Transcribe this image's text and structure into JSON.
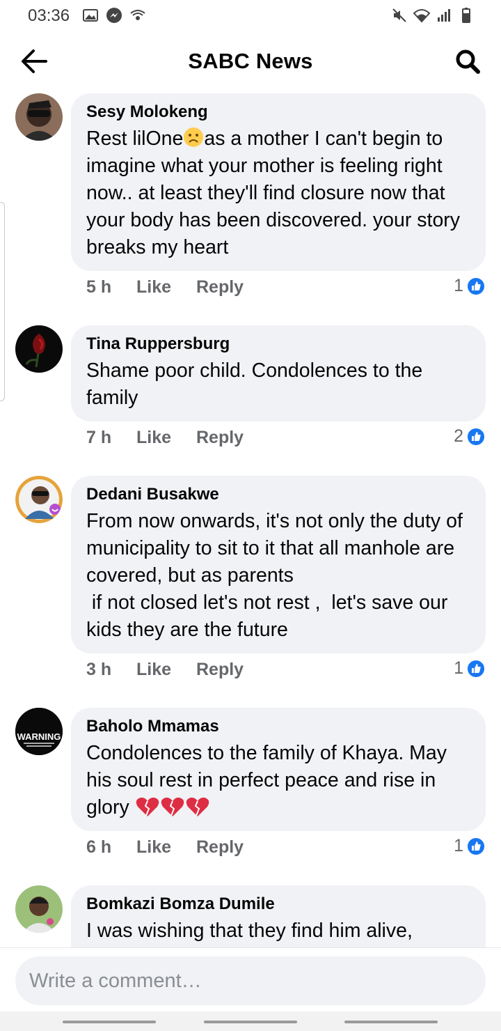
{
  "status_bar": {
    "time": "03:36",
    "left_icons": [
      "gallery-icon",
      "messenger-icon",
      "wifi-calling-icon"
    ],
    "right_icons": [
      "mute-icon",
      "wifi-icon",
      "signal-icon",
      "battery-icon"
    ]
  },
  "header": {
    "title": "SABC News",
    "back_icon": "back-arrow-icon",
    "search_icon": "search-icon"
  },
  "comments": [
    {
      "author": "Sesy Molokeng",
      "text_before_emoji": "Rest lilOne",
      "emoji": "sad-face",
      "text_after_emoji": "as a mother I can't begin to imagine what your mother is feeling right now.. at least they'll find closure now that your body has been discovered. your story breaks my heart",
      "time": "5 h",
      "like_label": "Like",
      "reply_label": "Reply",
      "reaction_count": "1"
    },
    {
      "author": "Tina Ruppersburg",
      "text": "Shame poor child. Condolences to the family",
      "time": "7 h",
      "like_label": "Like",
      "reply_label": "Reply",
      "reaction_count": "2"
    },
    {
      "author": "Dedani Busakwe",
      "text": "From now onwards, it's not only the duty of municipality to sit to it that all manhole are covered, but as parents\n if not closed let's not rest ,  let's save our kids they are the future",
      "time": "3 h",
      "like_label": "Like",
      "reply_label": "Reply",
      "reaction_count": "1"
    },
    {
      "author": "Baholo Mmamas",
      "text": "Condolences to the family of Khaya. May his soul rest in perfect peace and rise in glory ",
      "emoji": "broken-heart x3",
      "avatar_text": "WARNING",
      "time": "6 h",
      "like_label": "Like",
      "reply_label": "Reply",
      "reaction_count": "1"
    },
    {
      "author": "Bomkazi Bomza Dumile",
      "text": "I was wishing that they find him alive,"
    }
  ],
  "composer": {
    "placeholder": "Write a comment…"
  },
  "colors": {
    "bubble": "#f0f2f5",
    "meta_text": "#65676b",
    "like_blue": "#1877f2"
  }
}
